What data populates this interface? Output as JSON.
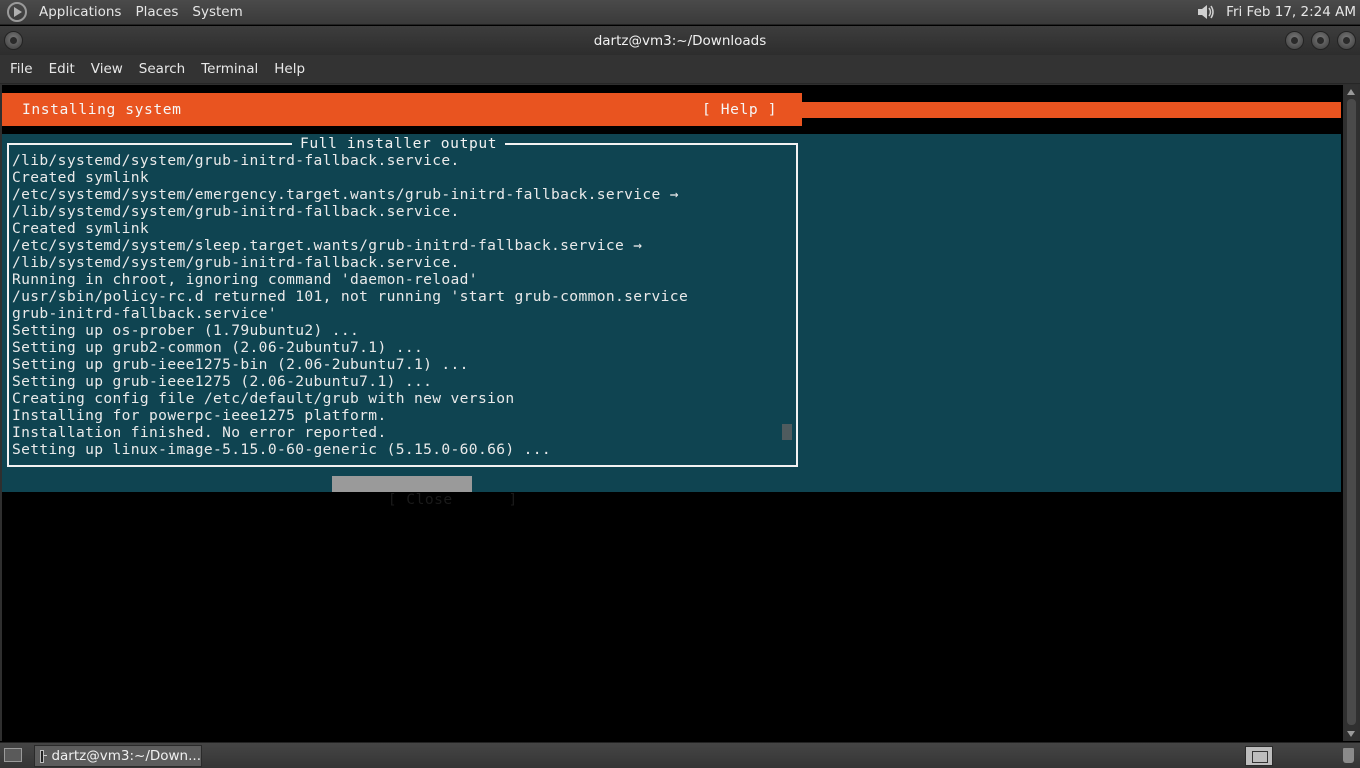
{
  "top_panel": {
    "menus": [
      "Applications",
      "Places",
      "System"
    ],
    "clock": "Fri Feb 17,  2:24 AM",
    "icons": {
      "logo": "gnome-foot-icon",
      "volume": "speaker-icon"
    }
  },
  "window": {
    "title": "dartz@vm3:~/Downloads",
    "menus": [
      "File",
      "Edit",
      "View",
      "Search",
      "Terminal",
      "Help"
    ]
  },
  "installer": {
    "header_title": "Installing system",
    "help_label": "[ Help ]",
    "output_title": "Full installer output",
    "output_lines": [
      "/lib/systemd/system/grub-initrd-fallback.service.",
      "Created symlink",
      "/etc/systemd/system/emergency.target.wants/grub-initrd-fallback.service →",
      "/lib/systemd/system/grub-initrd-fallback.service.",
      "Created symlink",
      "/etc/systemd/system/sleep.target.wants/grub-initrd-fallback.service →",
      "/lib/systemd/system/grub-initrd-fallback.service.",
      "Running in chroot, ignoring command 'daemon-reload'",
      "/usr/sbin/policy-rc.d returned 101, not running 'start grub-common.service",
      "grub-initrd-fallback.service'",
      "Setting up os-prober (1.79ubuntu2) ...",
      "Setting up grub2-common (2.06-2ubuntu7.1) ...",
      "Setting up grub-ieee1275-bin (2.06-2ubuntu7.1) ...",
      "Setting up grub-ieee1275 (2.06-2ubuntu7.1) ...",
      "Creating config file /etc/default/grub with new version",
      "Installing for powerpc-ieee1275 platform.",
      "Installation finished. No error reported.",
      "Setting up linux-image-5.15.0-60-generic (5.15.0-60.66) ..."
    ],
    "close_label": "[ Close      ]"
  },
  "bottom_panel": {
    "taskbar_item": "dartz@vm3:~/Down..."
  },
  "colors": {
    "accent_orange": "#e95420",
    "installer_teal": "#0f4451",
    "terminal_bg": "#000000"
  }
}
